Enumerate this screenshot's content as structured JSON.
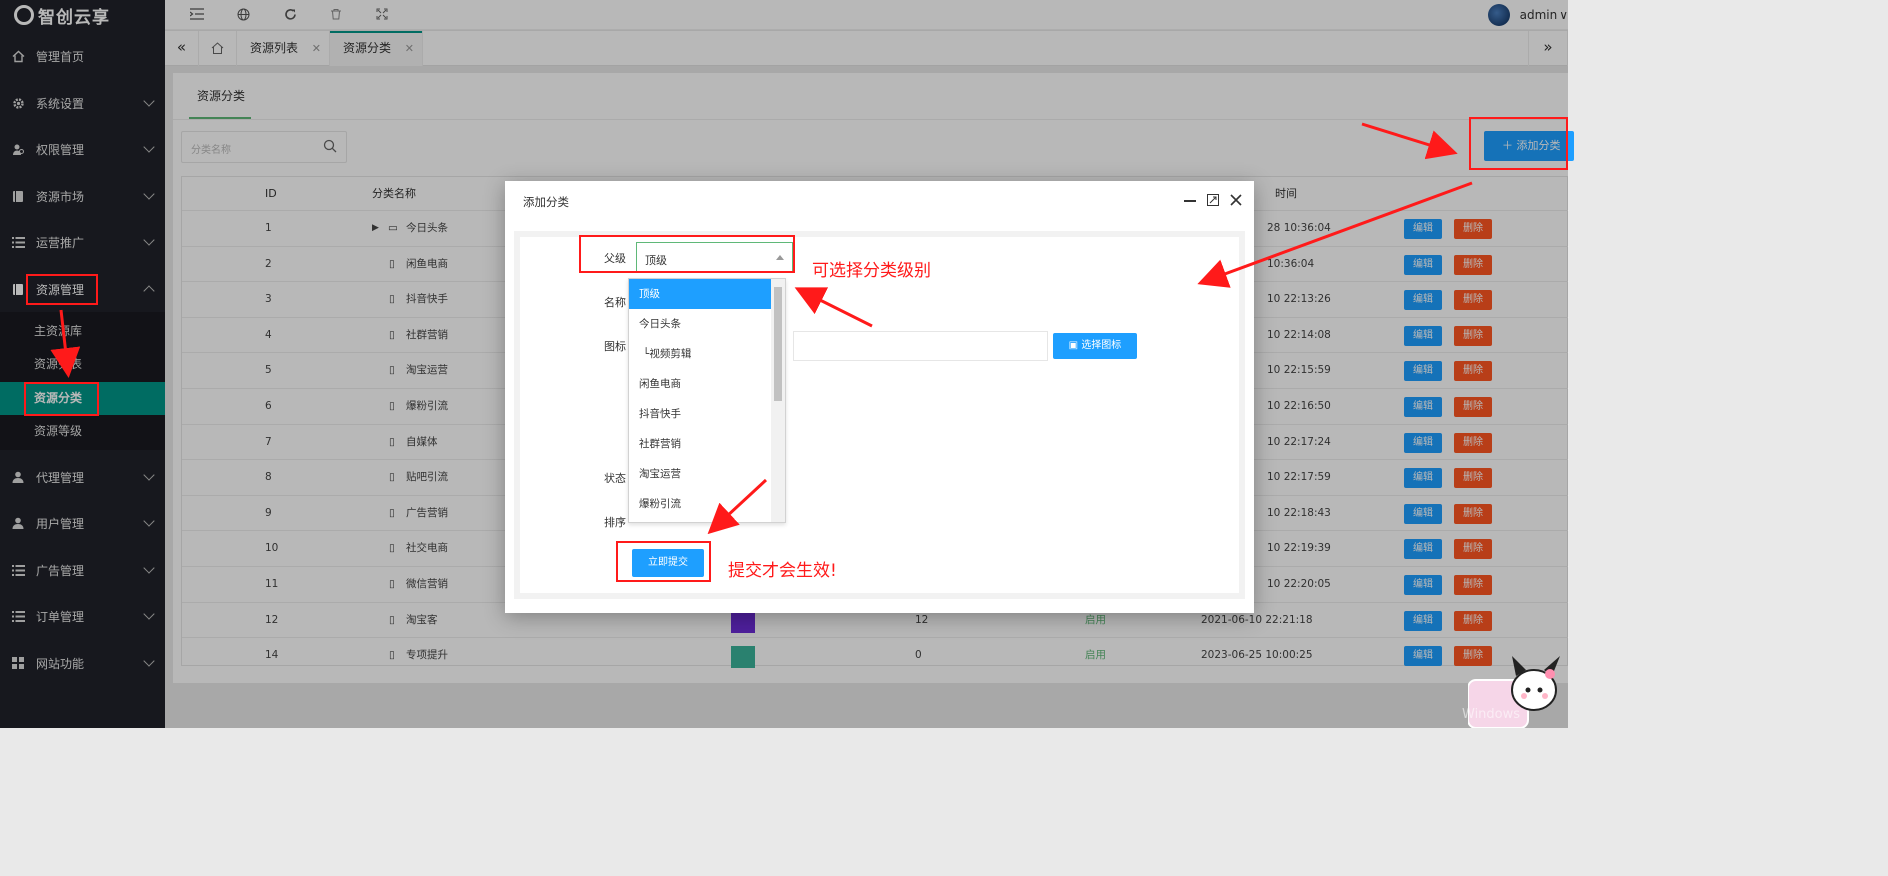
{
  "app": {
    "logo_text": "智创云享",
    "user": "admin"
  },
  "sidebar": {
    "items": [
      {
        "label": "管理首页",
        "icon": "home-icon"
      },
      {
        "label": "系统设置",
        "icon": "gear-icon"
      },
      {
        "label": "权限管理",
        "icon": "user-group-icon"
      },
      {
        "label": "资源市场",
        "icon": "book-icon"
      },
      {
        "label": "运营推广",
        "icon": "list-icon"
      },
      {
        "label": "资源管理",
        "icon": "book-icon"
      },
      {
        "label": "代理管理",
        "icon": "user-icon"
      },
      {
        "label": "用户管理",
        "icon": "user-icon"
      },
      {
        "label": "广告管理",
        "icon": "list-icon"
      },
      {
        "label": "订单管理",
        "icon": "list-icon"
      },
      {
        "label": "网站功能",
        "icon": "grid-icon"
      }
    ],
    "sub_items": [
      "主资源库",
      "资源列表",
      "资源分类",
      "资源等级"
    ]
  },
  "tabs": [
    {
      "label": "资源列表"
    },
    {
      "label": "资源分类"
    }
  ],
  "card": {
    "title": "资源分类",
    "search_placeholder": "分类名称",
    "add_button": "添加分类"
  },
  "table": {
    "headers": [
      "ID",
      "分类名称",
      "时间"
    ],
    "rows": [
      {
        "id": "1",
        "name": "今日头条",
        "time": "28 10:36:04"
      },
      {
        "id": "2",
        "name": "闲鱼电商",
        "time": "10:36:04"
      },
      {
        "id": "3",
        "name": "抖音快手",
        "time": "10 22:13:26"
      },
      {
        "id": "4",
        "name": "社群营销",
        "time": "10 22:14:08"
      },
      {
        "id": "5",
        "name": "淘宝运营",
        "time": "10 22:15:59"
      },
      {
        "id": "6",
        "name": "爆粉引流",
        "time": "10 22:16:50"
      },
      {
        "id": "7",
        "name": "自媒体",
        "time": "10 22:17:24"
      },
      {
        "id": "8",
        "name": "贴吧引流",
        "time": "10 22:17:59"
      },
      {
        "id": "9",
        "name": "广告营销",
        "time": "10 22:18:43"
      },
      {
        "id": "10",
        "name": "社交电商",
        "time": "10 22:19:39"
      },
      {
        "id": "11",
        "name": "微信营销",
        "time": "10 22:20:05"
      },
      {
        "id": "12",
        "name": "淘宝客",
        "sort": "12",
        "status": "启用",
        "time": "2021-06-10 22:21:18"
      },
      {
        "id": "14",
        "name": "专项提升",
        "sort": "0",
        "status": "启用",
        "time": "2023-06-25 10:00:25"
      }
    ],
    "edit_label": "编辑",
    "delete_label": "删除"
  },
  "modal": {
    "title": "添加分类",
    "labels": {
      "parent": "父级",
      "name": "名称",
      "icon": "图标",
      "status": "状态",
      "sort": "排序"
    },
    "parent_value": "顶级",
    "choose_icon_button": "选择图标",
    "submit_button": "立即提交",
    "dropdown_options": [
      "顶级",
      "今日头条",
      "└视频剪辑",
      "闲鱼电商",
      "抖音快手",
      "社群营销",
      "淘宝运营",
      "爆粉引流"
    ]
  },
  "annotations": {
    "select_level": "可选择分类级别",
    "submit_note": "提交才会生效!"
  },
  "watermark": "Windows",
  "colors": {
    "primary": "#1E9FFF",
    "danger": "#FF5722",
    "sidebar": "#20222a",
    "active": "#009688",
    "annotation": "#ff1a1a"
  }
}
